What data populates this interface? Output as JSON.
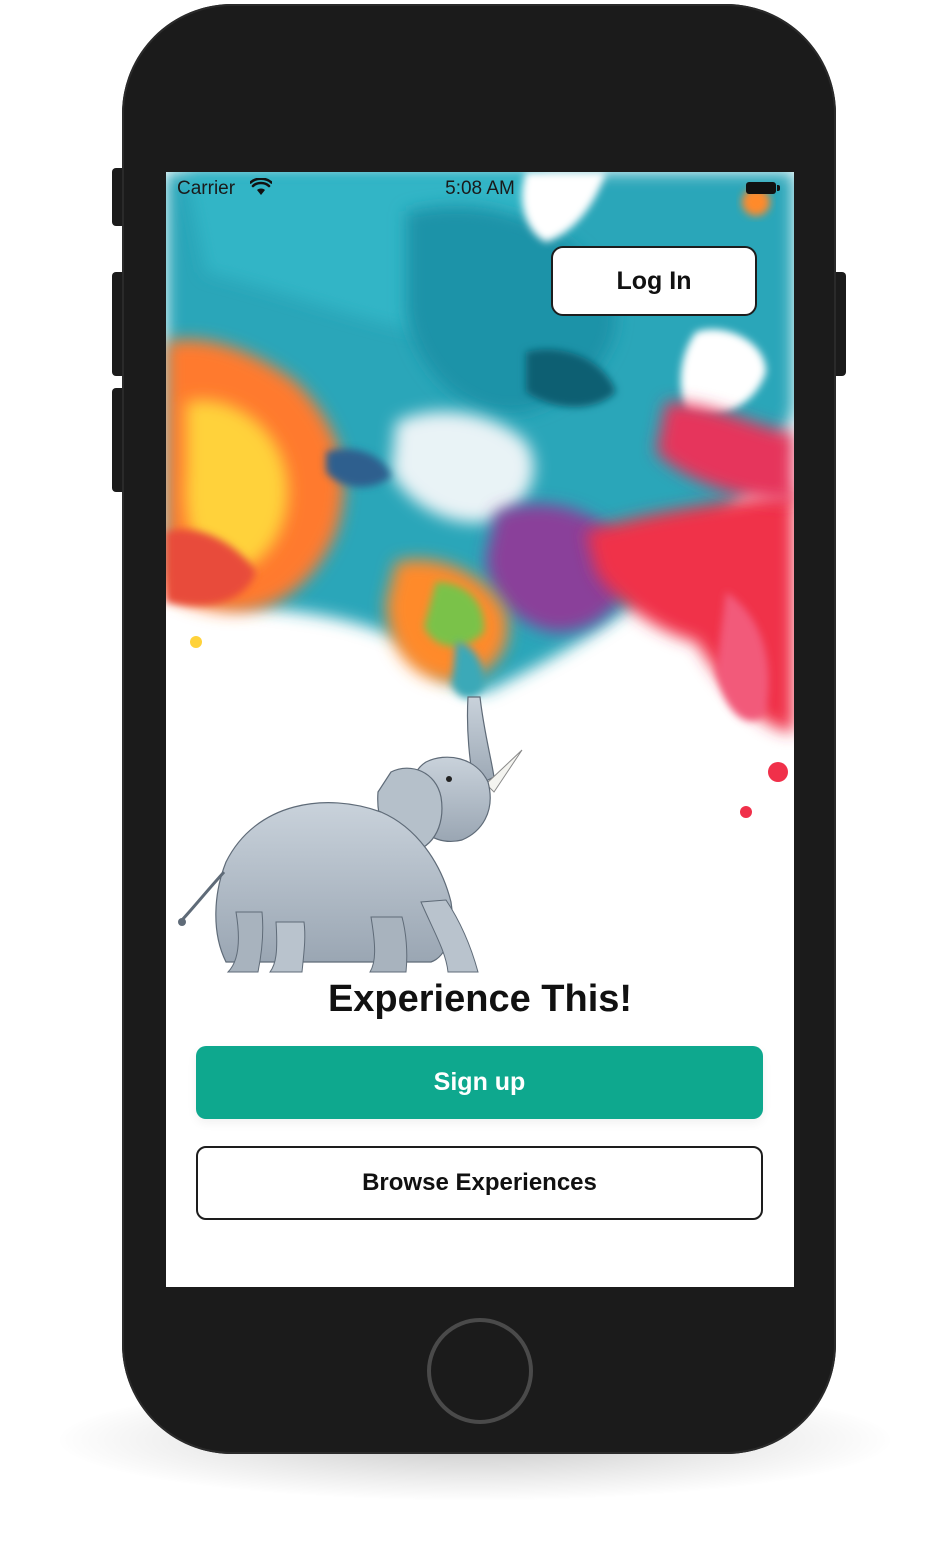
{
  "status_bar": {
    "carrier": "Carrier",
    "time": "5:08 AM",
    "wifi_icon": "wifi-icon",
    "battery_icon": "battery-icon"
  },
  "header": {
    "login_label": "Log In"
  },
  "hero": {
    "illustration": "elephant-spraying-paint-splash",
    "tagline": "Experience This!"
  },
  "actions": {
    "signup_label": "Sign up",
    "browse_label": "Browse Experiences"
  },
  "colors": {
    "primary": "#0ea88e",
    "phone_frame": "#1b1b1b",
    "text": "#111111"
  }
}
